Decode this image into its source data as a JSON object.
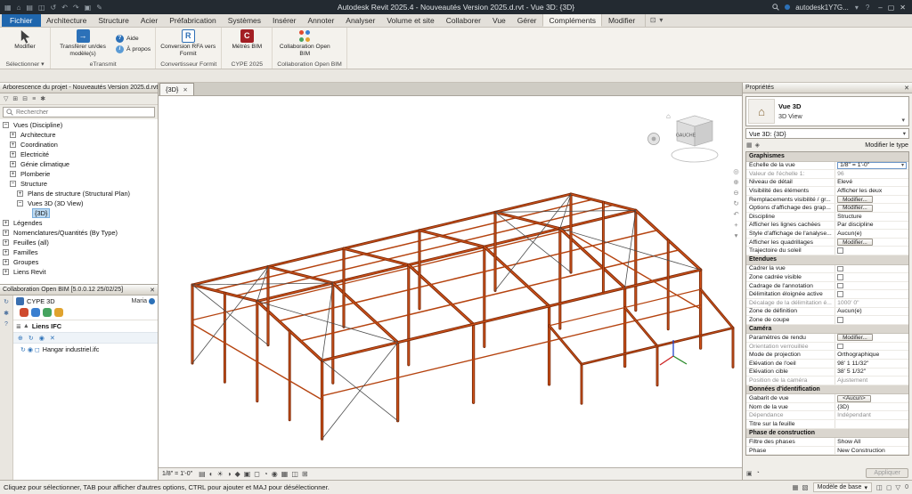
{
  "ui": {
    "close_glyph": "✕",
    "caret_down": "▾"
  },
  "window": {
    "title": "Autodesk Revit 2025.4 - Nouveautés Version 2025.d.rvt - Vue 3D: {3D}",
    "account": "autodesk1Y7G...",
    "help_glyph": "?",
    "qat_icons": [
      {
        "name": "app-menu-icon",
        "glyph": "▦"
      },
      {
        "name": "home-icon",
        "glyph": "⌂"
      },
      {
        "name": "open-icon",
        "glyph": "▤"
      },
      {
        "name": "save-icon",
        "glyph": "◫"
      },
      {
        "name": "sync-icon",
        "glyph": "↺"
      },
      {
        "name": "undo-icon",
        "glyph": "↶"
      },
      {
        "name": "redo-icon",
        "glyph": "↷"
      },
      {
        "name": "print-icon",
        "glyph": "▣"
      },
      {
        "name": "modify-pen-icon",
        "glyph": "✎"
      }
    ],
    "window_buttons": [
      {
        "name": "minimize-button",
        "glyph": "–"
      },
      {
        "name": "restore-button",
        "glyph": "▢"
      },
      {
        "name": "close-button",
        "glyph": "✕"
      }
    ]
  },
  "ribbon": {
    "file_tab": "Fichier",
    "tabs": [
      "Architecture",
      "Structure",
      "Acier",
      "Préfabrication",
      "Systèmes",
      "Insérer",
      "Annoter",
      "Analyser",
      "Volume et site",
      "Collaborer",
      "Vue",
      "Gérer",
      "Compléments",
      "Modifier"
    ],
    "active_tab": "Compléments",
    "tab_extra_icons": [
      {
        "name": "selection-box-icon",
        "glyph": "⊡"
      },
      {
        "name": "selection-caret-icon",
        "glyph": "▾"
      }
    ],
    "panels": [
      {
        "label": "Sélectionner ▾",
        "buttons": [
          {
            "kind": "big",
            "label": "Modifier",
            "icon": "cursor"
          }
        ]
      },
      {
        "label": "eTransmit",
        "buttons": [
          {
            "kind": "big",
            "label": "Transférer un/des modèle(s)",
            "icon": "etransmit"
          },
          {
            "kind": "smallcol",
            "items": [
              {
                "label": "Aide",
                "icon": "help"
              },
              {
                "label": "À propos",
                "icon": "info"
              }
            ]
          }
        ]
      },
      {
        "label": "Convertisseur Formit",
        "buttons": [
          {
            "kind": "big",
            "label": "Conversion RFA vers Formit",
            "icon": "formit"
          }
        ]
      },
      {
        "label": "CYPE 2025",
        "buttons": [
          {
            "kind": "big",
            "label": "Métrés BIM",
            "icon": "cype"
          }
        ]
      },
      {
        "label": "Collaboration Open BIM",
        "buttons": [
          {
            "kind": "big",
            "label": "Collaboration Open BIM",
            "icon": "openbim"
          }
        ]
      }
    ]
  },
  "project_browser": {
    "title": "Arborescence du projet - Nouveautés Version 2025.d.rvt",
    "search_placeholder": "Rechercher",
    "toolbar_icons": [
      {
        "name": "browser-filter-icon",
        "glyph": "▽"
      },
      {
        "name": "browser-expand-all-icon",
        "glyph": "⊞"
      },
      {
        "name": "browser-collapse-all-icon",
        "glyph": "⊟"
      },
      {
        "name": "browser-list-icon",
        "glyph": "≡"
      },
      {
        "name": "browser-settings-icon",
        "glyph": "✱"
      }
    ],
    "tree": [
      {
        "label": "Vues (Discipline)",
        "indent": 0,
        "exp": "minus"
      },
      {
        "label": "Architecture",
        "indent": 1,
        "exp": "plus"
      },
      {
        "label": "Coordination",
        "indent": 1,
        "exp": "plus"
      },
      {
        "label": "Electricité",
        "indent": 1,
        "exp": "plus"
      },
      {
        "label": "Génie climatique",
        "indent": 1,
        "exp": "plus"
      },
      {
        "label": "Plomberie",
        "indent": 1,
        "exp": "plus"
      },
      {
        "label": "Structure",
        "indent": 1,
        "exp": "minus"
      },
      {
        "label": "Plans de structure (Structural Plan)",
        "indent": 2,
        "exp": "plus"
      },
      {
        "label": "Vues 3D (3D View)",
        "indent": 2,
        "exp": "minus"
      },
      {
        "label": "{3D}",
        "indent": 3,
        "exp": "none",
        "selected": true
      },
      {
        "label": "Légendes",
        "indent": 0,
        "exp": "plus"
      },
      {
        "label": "Nomenclatures/Quantités (By Type)",
        "indent": 0,
        "exp": "plus"
      },
      {
        "label": "Feuilles (all)",
        "indent": 0,
        "exp": "plus"
      },
      {
        "label": "Familles",
        "indent": 0,
        "exp": "plus"
      },
      {
        "label": "Groupes",
        "indent": 0,
        "exp": "plus"
      },
      {
        "label": "Liens Revit",
        "indent": 0,
        "exp": "plus"
      }
    ]
  },
  "collaboration": {
    "title": "Collaboration Open BIM [5.0.0.12 25/02/25]",
    "app_name": "CYPE 3D",
    "user_name": "Maria",
    "links_label": "Liens IFC",
    "app_dot_colors": [
      "#cf4a2e",
      "#3a7fd0",
      "#45a35f",
      "#e0a32e"
    ],
    "rail_icons": [
      {
        "name": "collab-update-icon",
        "glyph": "↻"
      },
      {
        "name": "collab-settings-icon",
        "glyph": "✱"
      },
      {
        "name": "collab-help-icon",
        "glyph": "?"
      }
    ],
    "links_icons": [
      {
        "name": "links-list-icon",
        "glyph": "≣"
      },
      {
        "name": "links-up-icon",
        "glyph": "▲"
      }
    ],
    "toolbar_icons": [
      {
        "name": "ifc-import-icon",
        "glyph": "⊕"
      },
      {
        "name": "ifc-update-icon",
        "glyph": "↻"
      },
      {
        "name": "ifc-visibility-icon",
        "glyph": "◉"
      },
      {
        "name": "ifc-delete-icon",
        "glyph": "✕"
      }
    ],
    "file_item": {
      "label": "Hangar industriel.ifc",
      "icons": [
        {
          "name": "file-sync-icon",
          "glyph": "↻"
        },
        {
          "name": "file-eye-icon",
          "glyph": "◉"
        },
        {
          "name": "file-box-icon",
          "glyph": "◻"
        }
      ]
    }
  },
  "view": {
    "tab_label": "{3D}",
    "viewcube_label": "GAUCHE",
    "steel_colors": {
      "dark": "#7b2a08",
      "light": "#d0521a",
      "mid": "#b5430f",
      "bracing": "#4c4c4c"
    },
    "axis_colors": {
      "x": "#cc2222",
      "y": "#2a8a2a",
      "z": "#2244cc"
    },
    "nav_icons": [
      {
        "name": "navigation-wheel-icon",
        "glyph": "◎"
      },
      {
        "name": "zoom-in-icon",
        "glyph": "⊕"
      },
      {
        "name": "zoom-out-icon",
        "glyph": "⊖"
      },
      {
        "name": "orbit-icon",
        "glyph": "↻"
      },
      {
        "name": "rewind-icon",
        "glyph": "↶"
      },
      {
        "name": "pan-icon",
        "glyph": "+"
      },
      {
        "name": "nav-more-icon",
        "glyph": "▾"
      }
    ]
  },
  "view_bar": {
    "scale": "1/8\" = 1'-0\"",
    "icons": [
      {
        "name": "detail-level-icon",
        "glyph": "▤"
      },
      {
        "name": "visual-style-icon",
        "glyph": "◐"
      },
      {
        "name": "sun-path-icon",
        "glyph": "☀"
      },
      {
        "name": "shadows-icon",
        "glyph": "◑"
      },
      {
        "name": "rendering-icon",
        "glyph": "◆"
      },
      {
        "name": "crop-view-icon",
        "glyph": "▣"
      },
      {
        "name": "crop-visibility-icon",
        "glyph": "◻"
      },
      {
        "name": "temporary-hide-icon",
        "glyph": "◔"
      },
      {
        "name": "reveal-hidden-icon",
        "glyph": "◉"
      },
      {
        "name": "temporary-view-properties-icon",
        "glyph": "▦"
      },
      {
        "name": "worksharing-display-icon",
        "glyph": "◫"
      },
      {
        "name": "constraints-icon",
        "glyph": "⊞"
      }
    ]
  },
  "properties": {
    "header": "Propriétés",
    "type_family": "Vue 3D",
    "type_name": "3D View",
    "instance_selector": "Vue 3D: {3D}",
    "edit_type_label": "Modifier le type",
    "apply_label": "Appliquer",
    "edit_icons": [
      {
        "name": "edit-family-icon",
        "glyph": "▦"
      },
      {
        "name": "properties-browser-icon",
        "glyph": "◈"
      }
    ],
    "bottom_icons": [
      {
        "name": "properties-help-icon",
        "glyph": "▣"
      },
      {
        "name": "properties-pin-icon",
        "glyph": "◔"
      }
    ],
    "sections": [
      {
        "title": "Graphismes",
        "rows": [
          {
            "label": "Echelle de la vue",
            "value": "1/8\" = 1'-0\"",
            "kind": "select"
          },
          {
            "label": "Valeur de l'échelle  1:",
            "value": "96",
            "kind": "text",
            "muted": true
          },
          {
            "label": "Niveau de détail",
            "value": "Elevé",
            "kind": "text"
          },
          {
            "label": "Visibilité des éléments",
            "value": "Afficher les deux",
            "kind": "text"
          },
          {
            "label": "Remplacements visibilité / gr...",
            "value": "Modifier...",
            "kind": "button"
          },
          {
            "label": "Options d'affichage des grap...",
            "value": "Modifier...",
            "kind": "button"
          },
          {
            "label": "Discipline",
            "value": "Structure",
            "kind": "text"
          },
          {
            "label": "Afficher les lignes cachées",
            "value": "Par discipline",
            "kind": "text"
          },
          {
            "label": "Style d'affichage de l'analyse...",
            "value": "Aucun(e)",
            "kind": "text"
          },
          {
            "label": "Afficher les quadrillages",
            "value": "Modifier...",
            "kind": "button"
          },
          {
            "label": "Trajectoire du soleil",
            "value": "",
            "kind": "check"
          }
        ]
      },
      {
        "title": "Etendues",
        "rows": [
          {
            "label": "Cadrer la vue",
            "value": "",
            "kind": "check"
          },
          {
            "label": "Zone cadrée visible",
            "value": "",
            "kind": "check"
          },
          {
            "label": "Cadrage de l'annotation",
            "value": "",
            "kind": "check"
          },
          {
            "label": "Délimitation éloignée active",
            "value": "",
            "kind": "check"
          },
          {
            "label": "Décalage de la délimitation é...",
            "value": "1000' 0\"",
            "kind": "text",
            "muted": true
          },
          {
            "label": "Zone de définition",
            "value": "Aucun(e)",
            "kind": "text"
          },
          {
            "label": "Zone de coupe",
            "value": "",
            "kind": "check"
          }
        ]
      },
      {
        "title": "Caméra",
        "rows": [
          {
            "label": "Paramètres de rendu",
            "value": "Modifier...",
            "kind": "button"
          },
          {
            "label": "Orientation verrouillée",
            "value": "",
            "kind": "check",
            "muted": true
          },
          {
            "label": "Mode de projection",
            "value": "Orthographique",
            "kind": "text"
          },
          {
            "label": "Elévation de l'oeil",
            "value": "98' 1 11/32\"",
            "kind": "text"
          },
          {
            "label": "Elévation cible",
            "value": "38' 5 1/32\"",
            "kind": "text"
          },
          {
            "label": "Position de la caméra",
            "value": "Ajustement",
            "kind": "text",
            "muted": true
          }
        ]
      },
      {
        "title": "Données d'identification",
        "rows": [
          {
            "label": "Gabarit de vue",
            "value": "<Aucun>",
            "kind": "button"
          },
          {
            "label": "Nom de la vue",
            "value": "{3D}",
            "kind": "text"
          },
          {
            "label": "Dépendance",
            "value": "Indépendant",
            "kind": "text",
            "muted": true
          },
          {
            "label": "Titre sur la feuille",
            "value": "",
            "kind": "text"
          }
        ]
      },
      {
        "title": "Phase de construction",
        "rows": [
          {
            "label": "Filtre des phases",
            "value": "Show All",
            "kind": "text"
          },
          {
            "label": "Phase",
            "value": "New Construction",
            "kind": "text"
          }
        ]
      }
    ]
  },
  "status_bar": {
    "hint": "Cliquez pour sélectionner, TAB pour afficher d'autres options,  CTRL pour ajouter et MAJ pour désélectionner.",
    "model_label": "Modèle de base",
    "filter_count": "0",
    "left_icons": [
      {
        "name": "worksets-icon",
        "glyph": "▦"
      },
      {
        "name": "design-options-icon",
        "glyph": "▧"
      }
    ],
    "right_icons": [
      {
        "name": "exclude-options-icon",
        "glyph": "◫"
      },
      {
        "name": "select-links-icon",
        "glyph": "◻"
      },
      {
        "name": "filter-icon",
        "glyph": "▽"
      }
    ]
  }
}
